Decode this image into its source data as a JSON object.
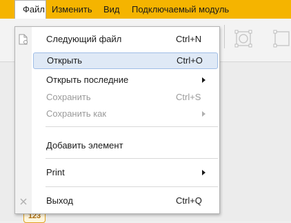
{
  "menubar": {
    "items": [
      {
        "label": "Файл"
      },
      {
        "label": "Изменить"
      },
      {
        "label": "Вид"
      },
      {
        "label": "Подключаемый модуль"
      }
    ]
  },
  "file_menu": {
    "next_file": {
      "label": "Следующий файл",
      "shortcut": "Ctrl+N"
    },
    "open": {
      "label": "Открыть",
      "shortcut": "Ctrl+O"
    },
    "open_recent": {
      "label": "Открыть последние"
    },
    "save": {
      "label": "Сохранить",
      "shortcut": "Ctrl+S"
    },
    "save_as": {
      "label": "Сохранить как"
    },
    "add_element": {
      "label": "Добавить элемент"
    },
    "print": {
      "label": "Print"
    },
    "exit": {
      "label": "Выход",
      "shortcut": "Ctrl+Q"
    }
  },
  "workspace": {
    "badge": "123"
  },
  "colors": {
    "menubar_bg": "#f5b400",
    "hover_bg": "#dfe9f6",
    "hover_border": "#9fbde6"
  }
}
